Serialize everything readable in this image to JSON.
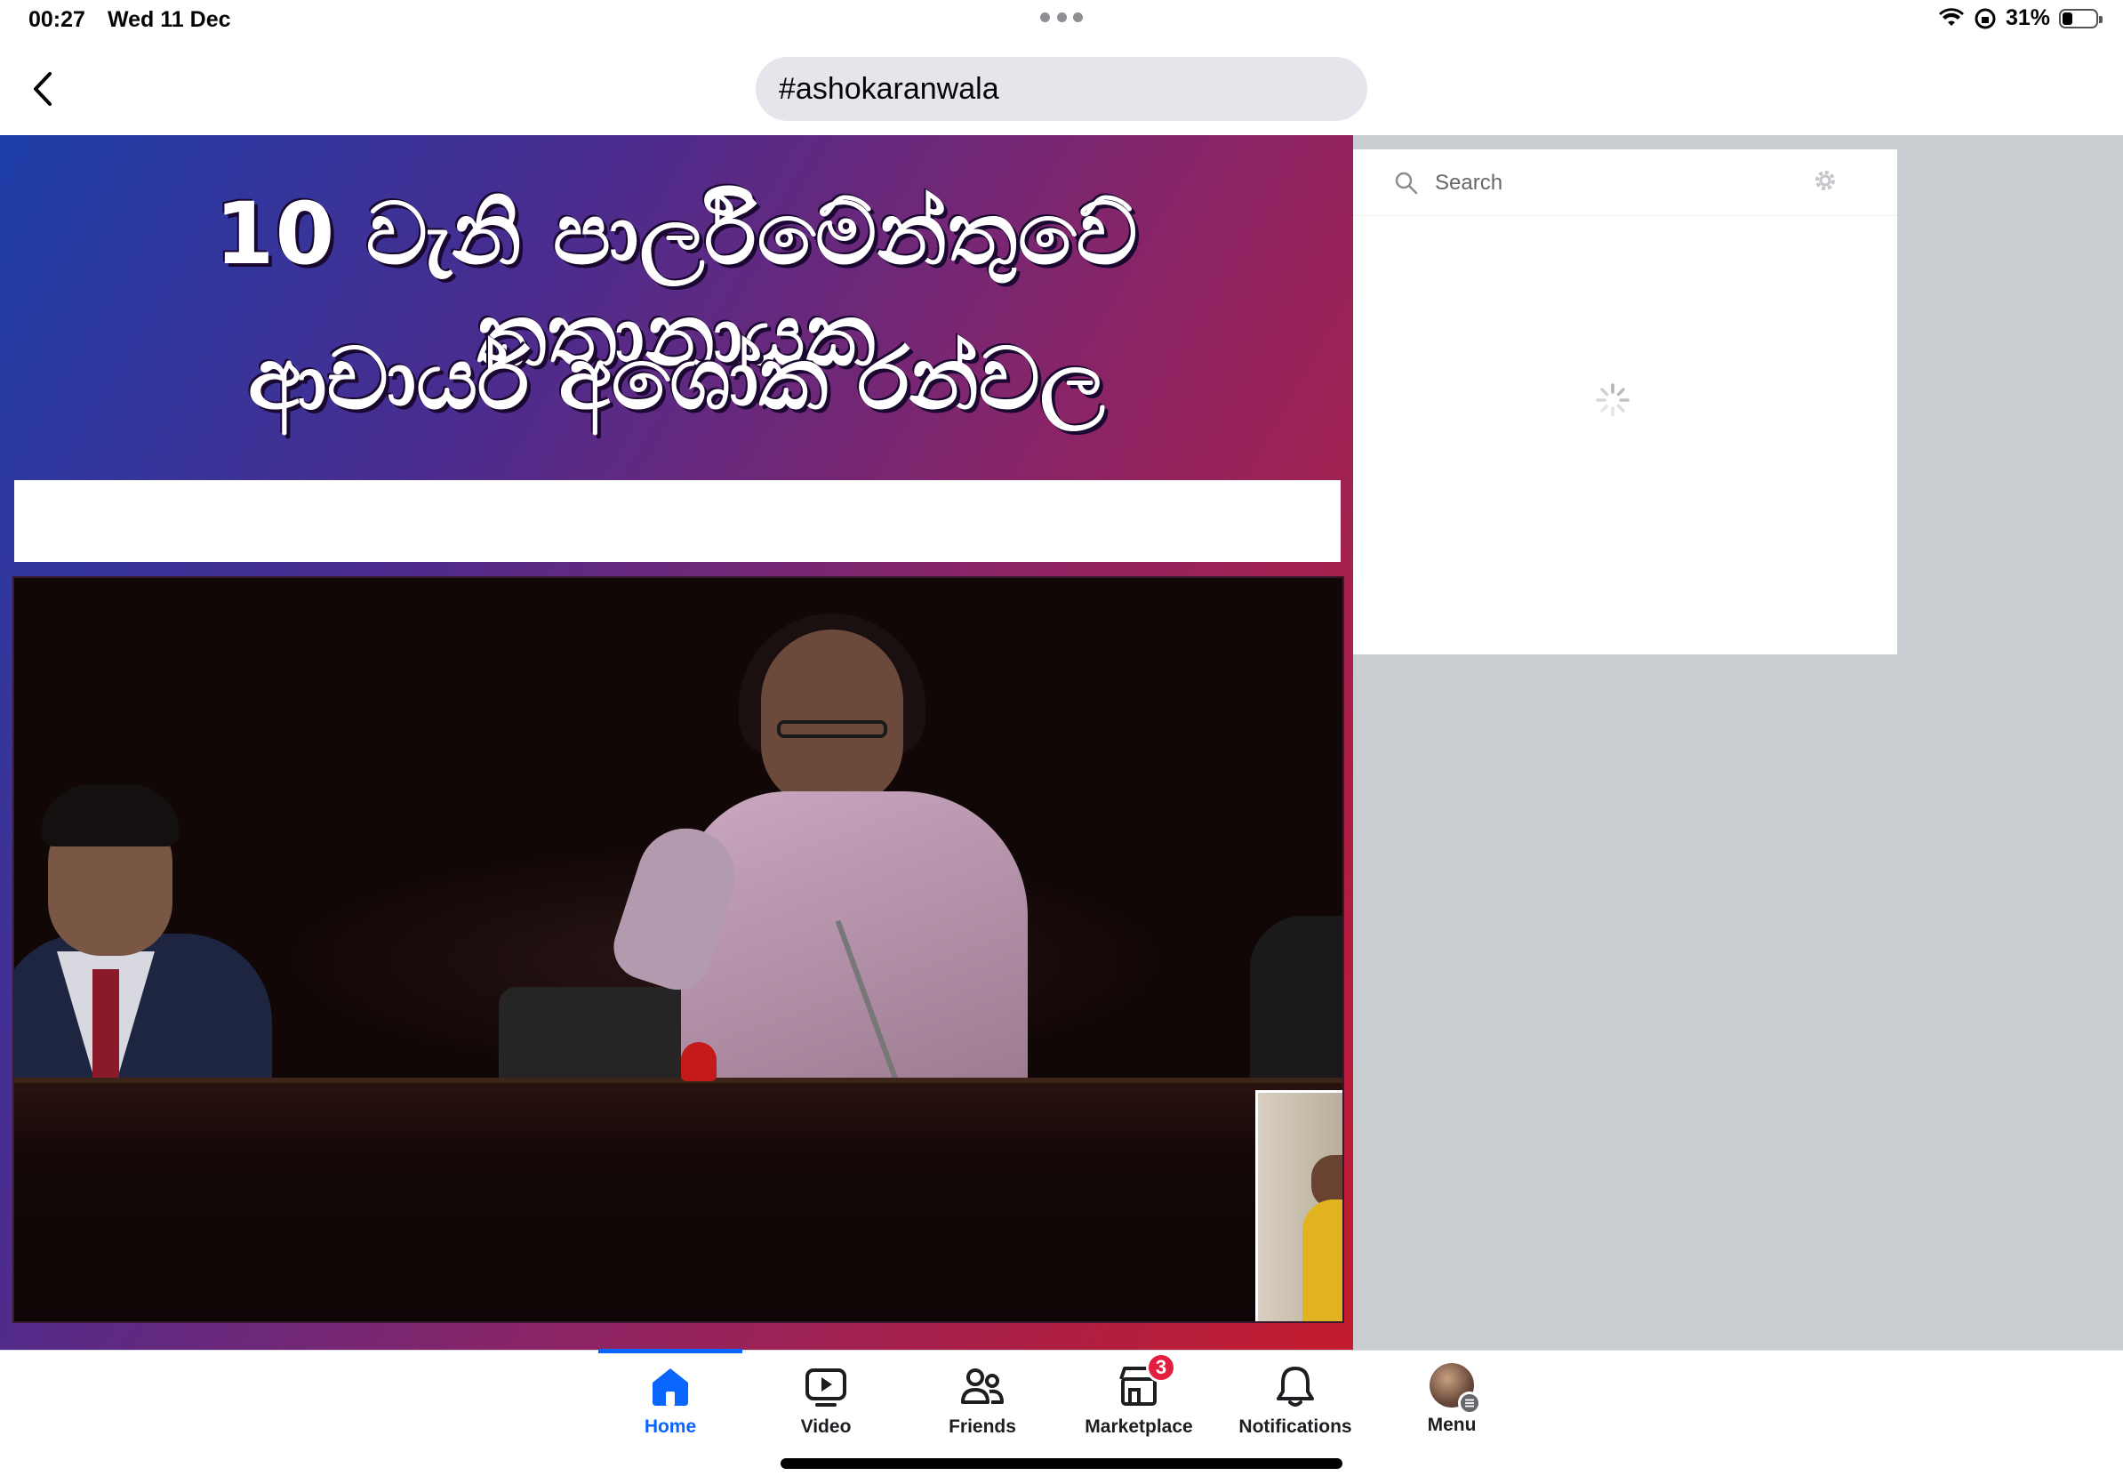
{
  "status_bar": {
    "time": "00:27",
    "date": "Wed 11 Dec",
    "battery": "31%",
    "battery_level": 0.31
  },
  "header": {
    "url_text": "#ashokaranwala"
  },
  "post": {
    "headline_line_1": "10 වැනි පාර්ලිමේන්තුවේ කතානායක",
    "headline_line_2": "ආචාර්ය අශෝක රන්වල"
  },
  "side_panel": {
    "search_placeholder": "Search"
  },
  "tabs": [
    {
      "label": "Home",
      "icon": "home-icon",
      "active": true
    },
    {
      "label": "Video",
      "icon": "video-icon"
    },
    {
      "label": "Friends",
      "icon": "friends-icon"
    },
    {
      "label": "Marketplace",
      "icon": "marketplace-icon",
      "badge": "3"
    },
    {
      "label": "Notifications",
      "icon": "bell-icon"
    },
    {
      "label": "Menu",
      "icon": "avatar"
    }
  ],
  "colors": {
    "accent": "#0866ff",
    "badge": "#e41e3f"
  }
}
